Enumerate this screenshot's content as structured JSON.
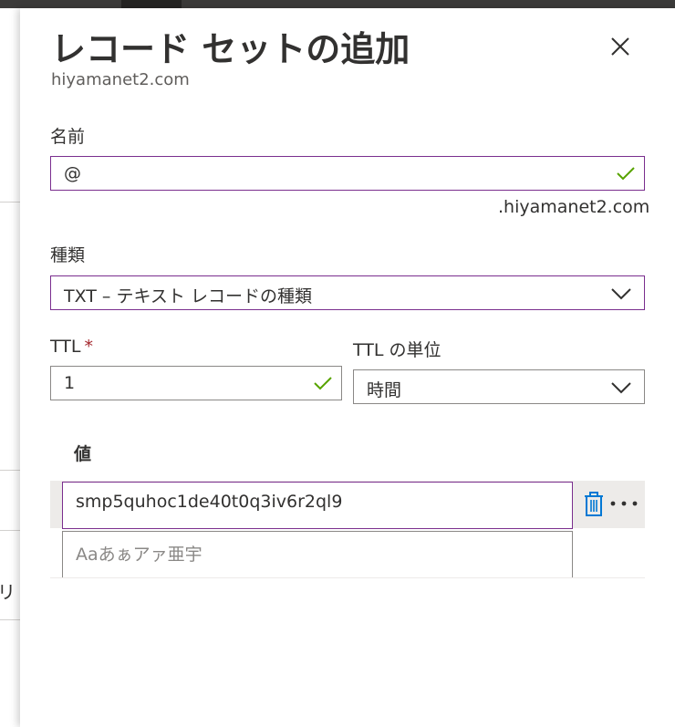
{
  "blade": {
    "title": "レコード セットの追加",
    "subtitle": "hiyamanet2.com"
  },
  "background": {
    "partial_text": "リソ"
  },
  "form": {
    "name": {
      "label": "名前",
      "value": "@",
      "suffix": ".hiyamanet2.com",
      "valid": true
    },
    "type": {
      "label": "種類",
      "value": "TXT – テキスト レコードの種類"
    },
    "ttl": {
      "label": "TTL",
      "required_mark": "*",
      "value": "1",
      "valid": true
    },
    "ttl_unit": {
      "label": "TTL の単位",
      "value": "時間"
    },
    "values": {
      "header": "値",
      "items": [
        {
          "value": "smp5quhoc1de40t0q3iv6r2ql9"
        }
      ],
      "new_placeholder": "Aaあぁアァ亜宇"
    }
  },
  "icons": {
    "close": "close-icon",
    "check": "checkmark-icon",
    "chevron": "chevron-down-icon",
    "delete": "trash-icon",
    "more": "more-icon"
  },
  "colors": {
    "focus_border": "#7a2e8e",
    "valid_check": "#57a300",
    "delete_icon": "#0078d4"
  }
}
